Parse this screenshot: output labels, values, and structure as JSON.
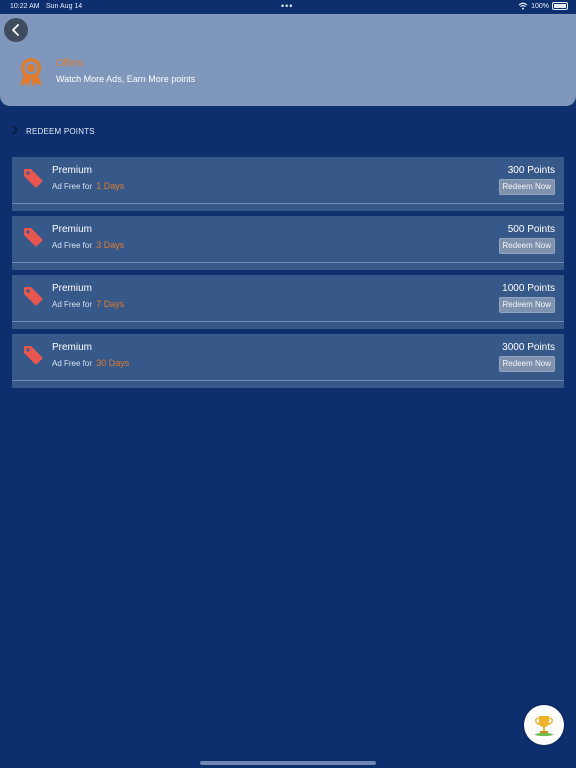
{
  "status_bar": {
    "time": "10:22 AM",
    "date": "Sun Aug 14",
    "dots": "•••",
    "battery": "100%"
  },
  "header": {
    "title": "Offers",
    "subtitle": "Watch More Ads, Earn More points"
  },
  "section": {
    "label": "REDEEM POINTS"
  },
  "rewards": [
    {
      "title": "Premium",
      "prefix": "Ad Free for",
      "days": "1 Days",
      "points": "300 Points",
      "button": "Redeem Now"
    },
    {
      "title": "Premium",
      "prefix": "Ad Free for",
      "days": "3 Days",
      "points": "500 Points",
      "button": "Redeem Now"
    },
    {
      "title": "Premium",
      "prefix": "Ad Free for",
      "days": "7 Days",
      "points": "1000 Points",
      "button": "Redeem Now"
    },
    {
      "title": "Premium",
      "prefix": "Ad Free for",
      "days": "30 Days",
      "points": "3000 Points",
      "button": "Redeem Now"
    }
  ],
  "colors": {
    "background": "#0d2f6e",
    "header": "#7e97bb",
    "card": "#37598a",
    "accent": "#e07a2c",
    "tag": "#e8574f"
  },
  "icons": {
    "back": "chevron-left-icon",
    "award": "award-icon",
    "tag": "price-tag-icon",
    "fab": "trophy-icon",
    "wifi": "wifi-icon",
    "battery": "battery-icon"
  }
}
